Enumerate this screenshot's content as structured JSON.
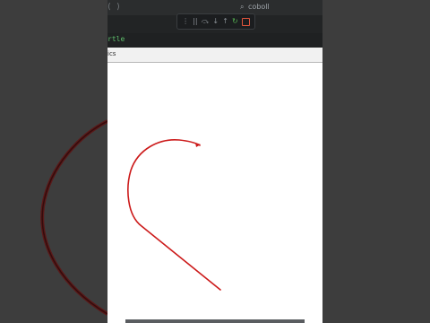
{
  "titlebar": {
    "icons": [
      "back-arrow-icon",
      "forward-arrow-icon"
    ],
    "search_text": "coboll"
  },
  "debug_toolbar": {
    "buttons": [
      "grip-icon",
      "pause-icon",
      "step-over-icon",
      "step-into-icon",
      "step-out-icon",
      "restart-icon",
      "stop-icon"
    ],
    "glyphs": [
      "⋮",
      "||",
      "⤼",
      "↓",
      "↑",
      "↻",
      ""
    ],
    "colors": {
      "restart": "#56b453",
      "stop": "#e0553c"
    }
  },
  "editor": {
    "fragment": "rtle"
  },
  "turtle_window": {
    "title_fragment": "ics"
  },
  "drawing": {
    "pen_color": "#cc1a1a",
    "shape": "heart-outline-partial"
  }
}
